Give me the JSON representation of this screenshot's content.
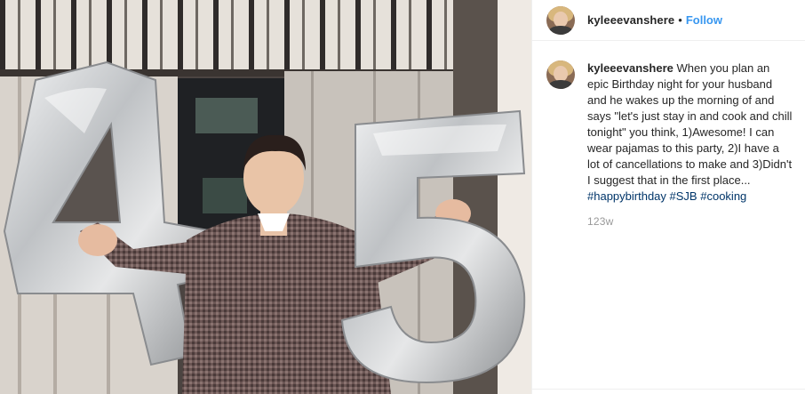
{
  "post": {
    "username": "kyleeevanshere",
    "separator": "•",
    "follow_label": "Follow"
  },
  "caption": {
    "username": "kyleeevanshere",
    "text": "When you plan an epic Birthday night for your husband and he wakes up the morning of and says \"let's just stay in and cook and chill tonight\" you think, 1)Awesome! I can wear pajamas to this party, 2)I have a lot of cancellations to make and 3)Didn't I suggest that in the first place...",
    "hashtags": [
      "#happybirthday",
      "#SJB",
      "#cooking"
    ],
    "age": "123w"
  },
  "photo": {
    "balloon_left": "4",
    "balloon_right": "5",
    "colors": {
      "balloon": "#cfd1d3",
      "shirt": "#5b4a48",
      "curtain": "#e8e4de",
      "window": "#2a2c2f"
    }
  }
}
